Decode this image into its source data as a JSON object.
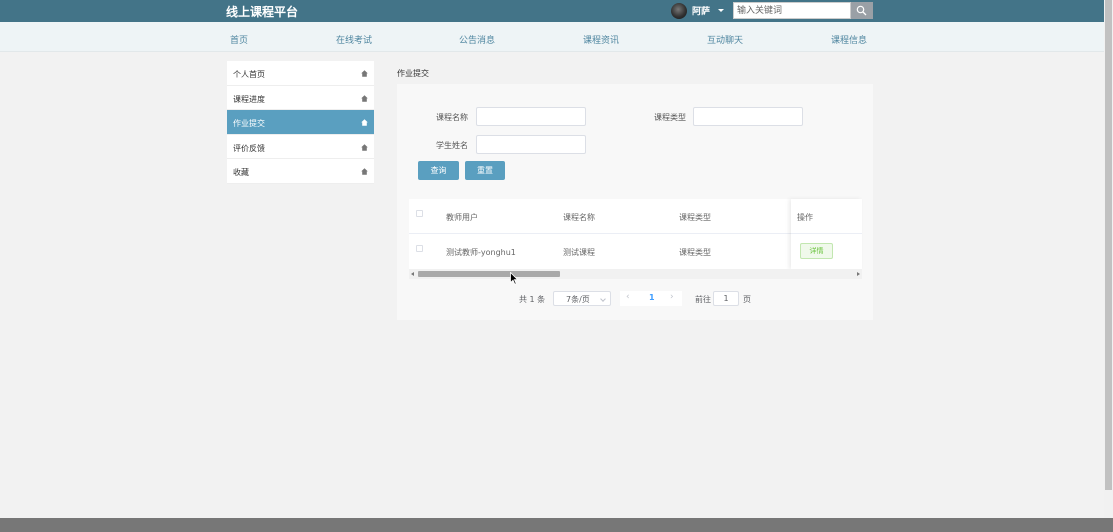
{
  "header": {
    "brand": "线上课程平台",
    "username": "阿萨",
    "search_placeholder": "输入关键词"
  },
  "nav": [
    "首页",
    "在线考试",
    "公告消息",
    "课程资讯",
    "互动聊天",
    "课程信息"
  ],
  "sidebar": {
    "items": [
      {
        "label": "个人首页"
      },
      {
        "label": "课程进度"
      },
      {
        "label": "作业提交",
        "active": true
      },
      {
        "label": "评价反馈"
      },
      {
        "label": "收藏"
      }
    ]
  },
  "page": {
    "title": "作业提交"
  },
  "filters": {
    "course_name_label": "课程名称",
    "course_type_label": "课程类型",
    "student_name_label": "学生姓名",
    "query_button": "查询",
    "reset_button": "重置"
  },
  "table": {
    "headers": [
      "教师用户",
      "课程名称",
      "课程类型",
      "操作"
    ],
    "rows": [
      {
        "teacher": "测试教师-yonghu1",
        "course_name": "测试课程",
        "course_type": "课程类型",
        "action": "详情"
      }
    ]
  },
  "pagination": {
    "total_text": "共 1 条",
    "page_size": "7条/页",
    "current_page": "1",
    "goto_prefix": "前往",
    "goto_value": "1",
    "goto_suffix": "页"
  },
  "colors": {
    "topbar": "#437488",
    "nav_text": "#4f86a0",
    "accent": "#5a9fc0",
    "detail_green": "#67c23a"
  }
}
